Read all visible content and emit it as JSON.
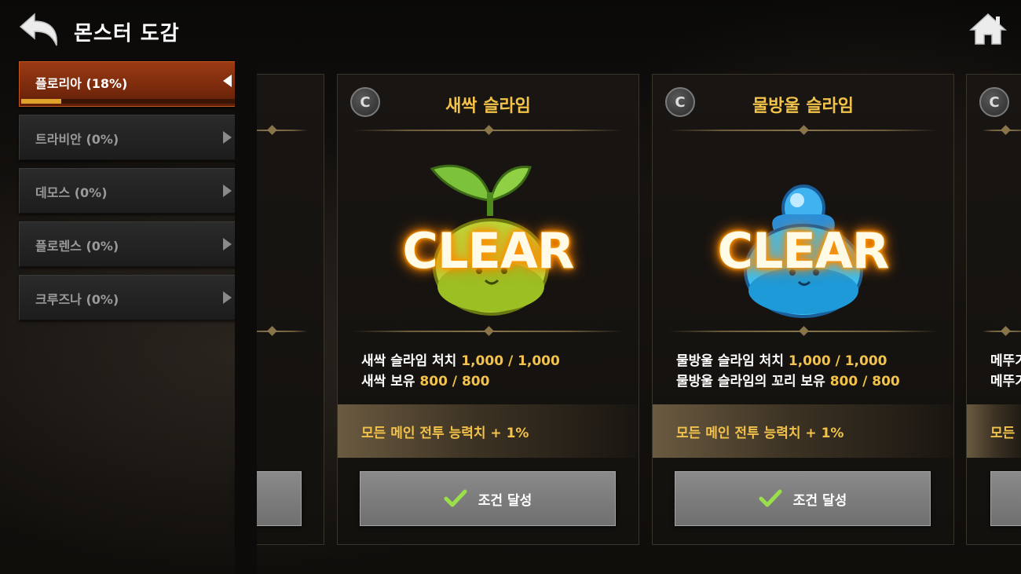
{
  "header": {
    "title": "몬스터 도감"
  },
  "sidebar": {
    "items": [
      {
        "label": "플로리아 (18%)",
        "active": true,
        "progress": 0.18
      },
      {
        "label": "트라비안 (0%)",
        "active": false
      },
      {
        "label": "데모스 (0%)",
        "active": false
      },
      {
        "label": "플로렌스 (0%)",
        "active": false
      },
      {
        "label": "크루즈나 (0%)",
        "active": false
      }
    ]
  },
  "cards": [
    {
      "grade": "C",
      "name": "새싹 슬라임",
      "clear_text": "CLEAR",
      "req_line1": "새싹 슬라임 처치",
      "req_line1_num": "1,000 / 1,000",
      "req_line2": "새싹 보유",
      "req_line2_num": "800 / 800",
      "reward": "모든 메인 전투 능력치 + 1%",
      "status_label": "조건 달성"
    },
    {
      "grade": "C",
      "name": "물방울 슬라임",
      "clear_text": "CLEAR",
      "req_line1": "물방울 슬라임 처치",
      "req_line1_num": "1,000 / 1,000",
      "req_line2": "물방울 슬라임의 꼬리 보유",
      "req_line2_num": "800 / 800",
      "reward": "모든 메인 전투 능력치 + 1%",
      "status_label": "조건 달성"
    }
  ],
  "partial_right_card": {
    "grade": "C",
    "req_line1": "메뚜기",
    "req_line2": "메뚜기",
    "reward": "모든"
  },
  "colors": {
    "accent_gold": "#f2c24a",
    "active_tab": "#9a3a14",
    "clear_glow": "#ff8c00"
  },
  "icons": {
    "back": "back-arrow-icon",
    "home": "home-icon",
    "grade": "grade-c-icon",
    "check": "checkmark-icon"
  }
}
